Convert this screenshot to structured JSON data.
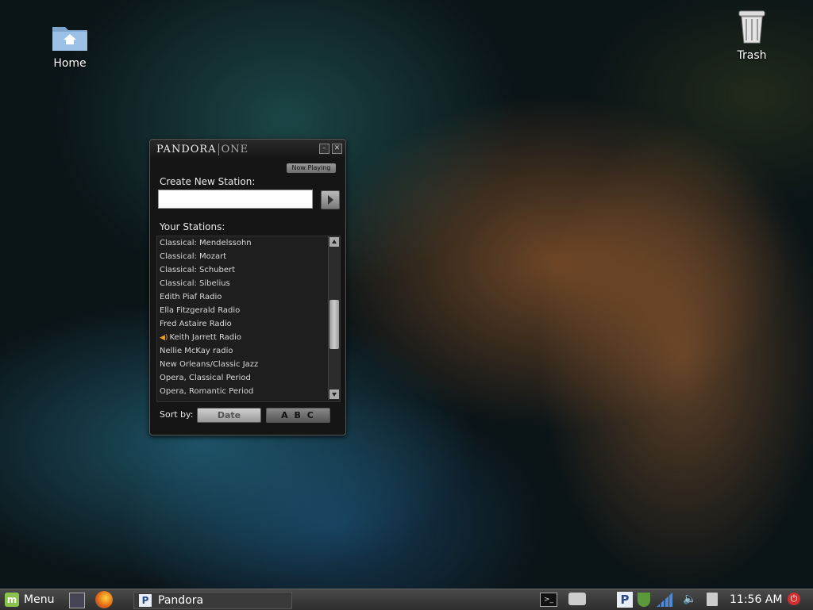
{
  "desktop": {
    "icons": [
      {
        "label": "Home",
        "icon": "home-folder-icon"
      },
      {
        "label": "Trash",
        "icon": "trash-icon"
      }
    ]
  },
  "pandora": {
    "brand": "PANDORA",
    "brand_suffix": "ONE",
    "now_playing_label": "Now Playing",
    "create_label": "Create New Station:",
    "create_input_value": "",
    "stations_label": "Your Stations:",
    "stations": [
      "Classical: Mendelssohn",
      "Classical: Mozart",
      "Classical: Schubert",
      "Classical: Sibelius",
      "Edith Piaf Radio",
      "Ella Fitzgerald Radio",
      "Fred Astaire Radio",
      "Keith Jarrett Radio",
      "Nellie McKay radio",
      "New Orleans/Classic Jazz",
      "Opera, Classical Period",
      "Opera, Romantic Period"
    ],
    "playing_station": "Keith Jarrett Radio",
    "sort_label": "Sort by:",
    "sort_date": "Date",
    "sort_abc": "A B C",
    "colors": {
      "playing_icon": "#f0a020",
      "background": "#151515"
    }
  },
  "taskbar": {
    "menu_label": "Menu",
    "task_label": "Pandora",
    "clock": "11:56 AM"
  }
}
